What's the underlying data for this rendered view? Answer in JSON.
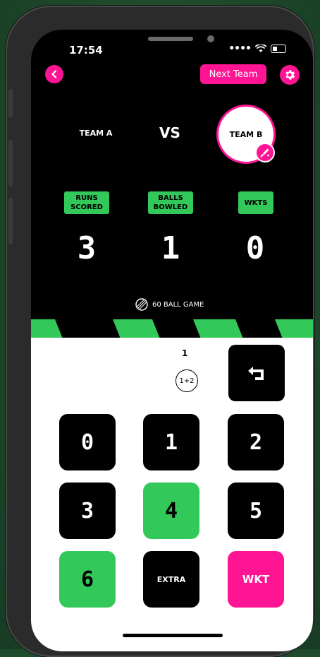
{
  "status_bar": {
    "time": "17:54"
  },
  "header": {
    "next_team_label": "Next Team"
  },
  "teams": {
    "team_a": "TEAM A",
    "vs": "VS",
    "team_b": "TEAM B"
  },
  "stats": {
    "runs_label": "RUNS SCORED",
    "runs_value": "3",
    "balls_label": "BALLS BOWLED",
    "balls_value": "1",
    "wkts_label": "WKTS",
    "wkts_value": "0"
  },
  "game": {
    "label": "60 BALL GAME"
  },
  "over": {
    "ball_number": "1",
    "last_ball": "1+2"
  },
  "keys": {
    "k0": "0",
    "k1": "1",
    "k2": "2",
    "k3": "3",
    "k4": "4",
    "k5": "5",
    "k6": "6",
    "extra": "EXTRA",
    "wkt": "WKT"
  },
  "colors": {
    "accent_pink": "#ff1493",
    "accent_green": "#32c85a",
    "background_green": "#1f4a2c"
  }
}
